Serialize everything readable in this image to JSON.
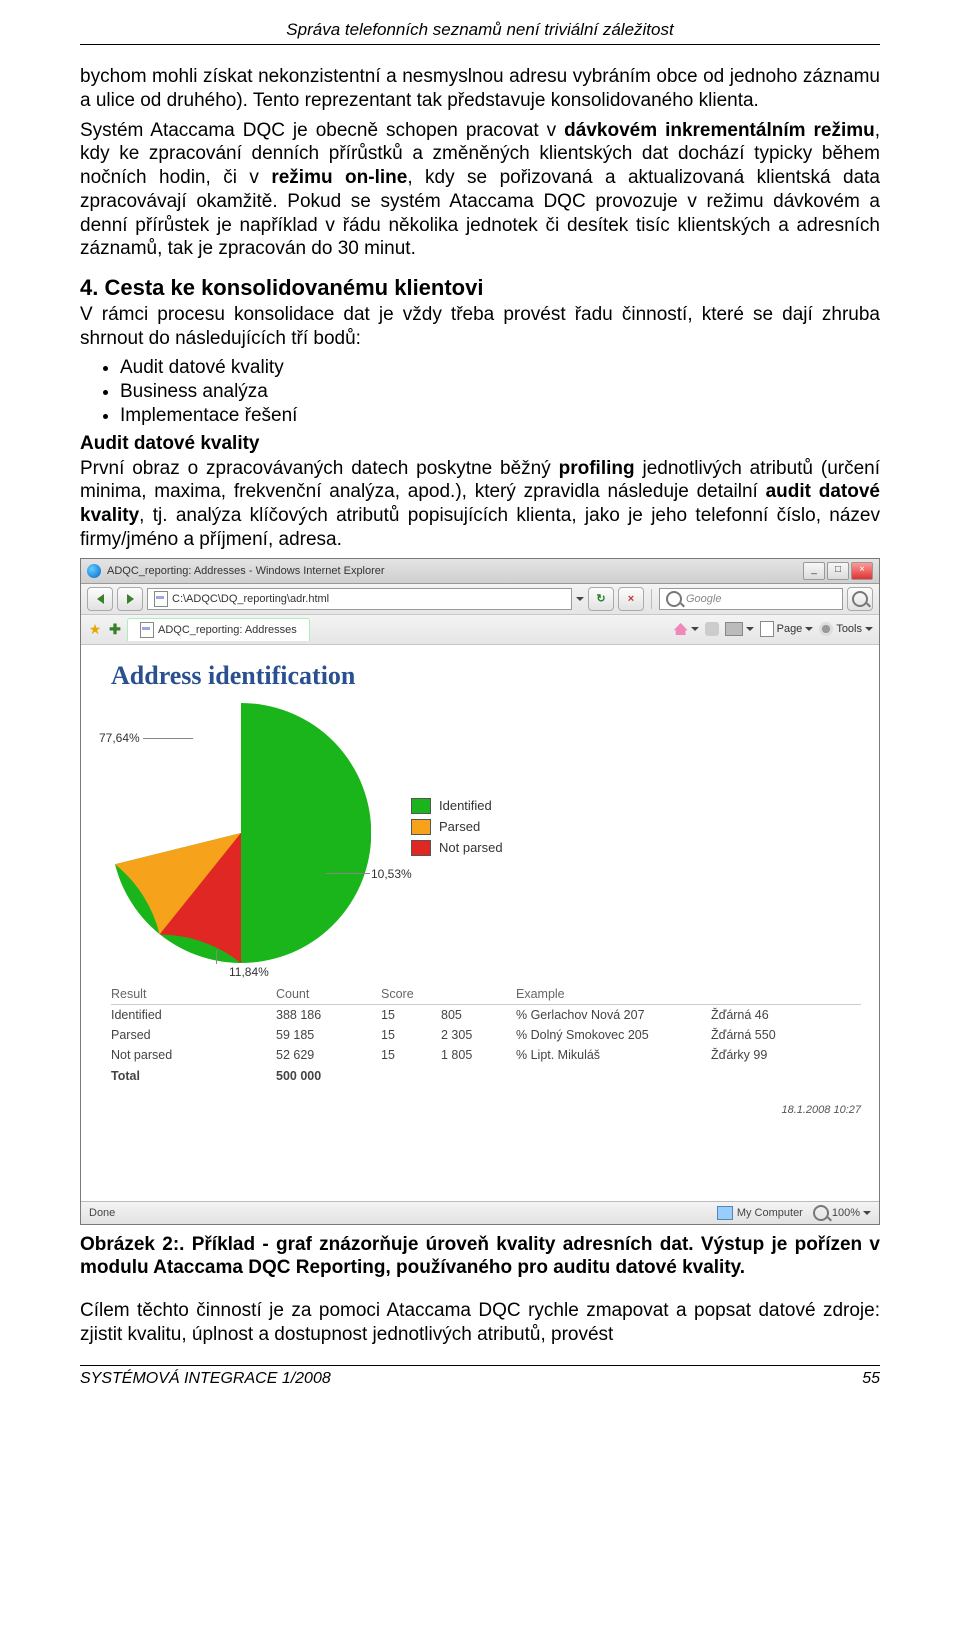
{
  "header": "Správa telefonních seznamů není triviální záležitost",
  "para1": "bychom mohli získat nekonzistentní a nesmyslnou adresu vybráním obce od jednoho záznamu a ulice od druhého). Tento reprezentant tak představuje konsolidovaného klienta.",
  "para2_a": "Systém Ataccama DQC je obecně schopen pracovat v ",
  "para2_b": "dávkovém inkrementálním režimu",
  "para2_c": ", kdy ke zpracování denních přírůstků a změněných klientských dat dochází typicky během nočních hodin, či v ",
  "para2_d": "režimu on-line",
  "para2_e": ", kdy se pořizovaná a aktualizovaná klientská data zpracovávají okamžitě. Pokud se systém Ataccama DQC provozuje v režimu dávkovém a denní přírůstek je například v řádu několika jednotek či desítek tisíc klientských a adresních záznamů, tak je zpracován do 30 minut.",
  "section4_title": "4.  Cesta ke konsolidovanému klientovi",
  "section4_intro": "V rámci procesu konsolidace dat je vždy třeba provést řadu činností, které se dají zhruba shrnout do následujících tří bodů:",
  "bullets": [
    "Audit datové kvality",
    "Business analýza",
    "Implementace řešení"
  ],
  "audit_head": "Audit datové kvality",
  "audit_a": "První obraz o zpracovávaných datech poskytne běžný ",
  "audit_b": "profiling",
  "audit_c": " jednotlivých atributů (určení minima, maxima, frekvenční analýza, apod.), který zpravidla následuje detailní ",
  "audit_d": "audit datové kvality",
  "audit_e": ", tj. analýza klíčových atributů popisujících klienta, jako je jeho telefonní číslo, název firmy/jméno a příjmení, adresa.",
  "browser": {
    "title": "ADQC_reporting: Addresses - Windows Internet Explorer",
    "address": "C:\\ADQC\\DQ_reporting\\adr.html",
    "search_placeholder": "Google",
    "tab_title": "ADQC_reporting: Addresses",
    "tool_home": "",
    "tool_page": "Page",
    "tool_tools": "Tools",
    "report_title": "Address identification",
    "legend": [
      "Identified",
      "Parsed",
      "Not parsed"
    ],
    "pie_labels": {
      "top": "77,64%",
      "mid": "10,53%",
      "bot": "11,84%"
    },
    "table": {
      "headers": [
        "Result",
        "Count",
        "Score",
        "",
        "Example",
        ""
      ],
      "rows": [
        [
          "Identified",
          "388 186",
          "15",
          "805",
          "% Gerlachov Nová  207",
          "Žďárná  46"
        ],
        [
          "Parsed",
          "59 185",
          "15",
          "2 305",
          "% Dolný Smokovec 205",
          "Žďárná  550"
        ],
        [
          "Not parsed",
          "52 629",
          "15",
          "1 805",
          "% Lipt. Mikuláš",
          "Žďárky  99"
        ]
      ],
      "total_label": "Total",
      "total_value": "500 000"
    },
    "timestamp": "18.1.2008 10:27",
    "status_left": "Done",
    "status_comp": "My Computer",
    "status_zoom": "100%"
  },
  "caption_a": "Obrázek 2:. Příklad - graf znázorňuje úroveň kvality adresních dat. Výstup je pořízen v modulu Ataccama DQC Reporting, používaného pro auditu datové kvality.",
  "para_end": "Cílem těchto činností je za pomoci Ataccama DQC rychle zmapovat a popsat datové zdroje: zjistit kvalitu, úplnost a dostupnost jednotlivých atributů, provést",
  "footer_left": "SYSTÉMOVÁ INTEGRACE 1/2008",
  "footer_right": "55",
  "chart_data": {
    "type": "pie",
    "title": "Address identification",
    "series": [
      {
        "name": "Identified",
        "value": 77.64,
        "count": 388186,
        "color": "#1ab51a"
      },
      {
        "name": "Parsed",
        "value": 11.84,
        "count": 59185,
        "color": "#f7a21b"
      },
      {
        "name": "Not parsed",
        "value": 10.53,
        "count": 52629,
        "color": "#e02723"
      }
    ],
    "total": 500000
  }
}
